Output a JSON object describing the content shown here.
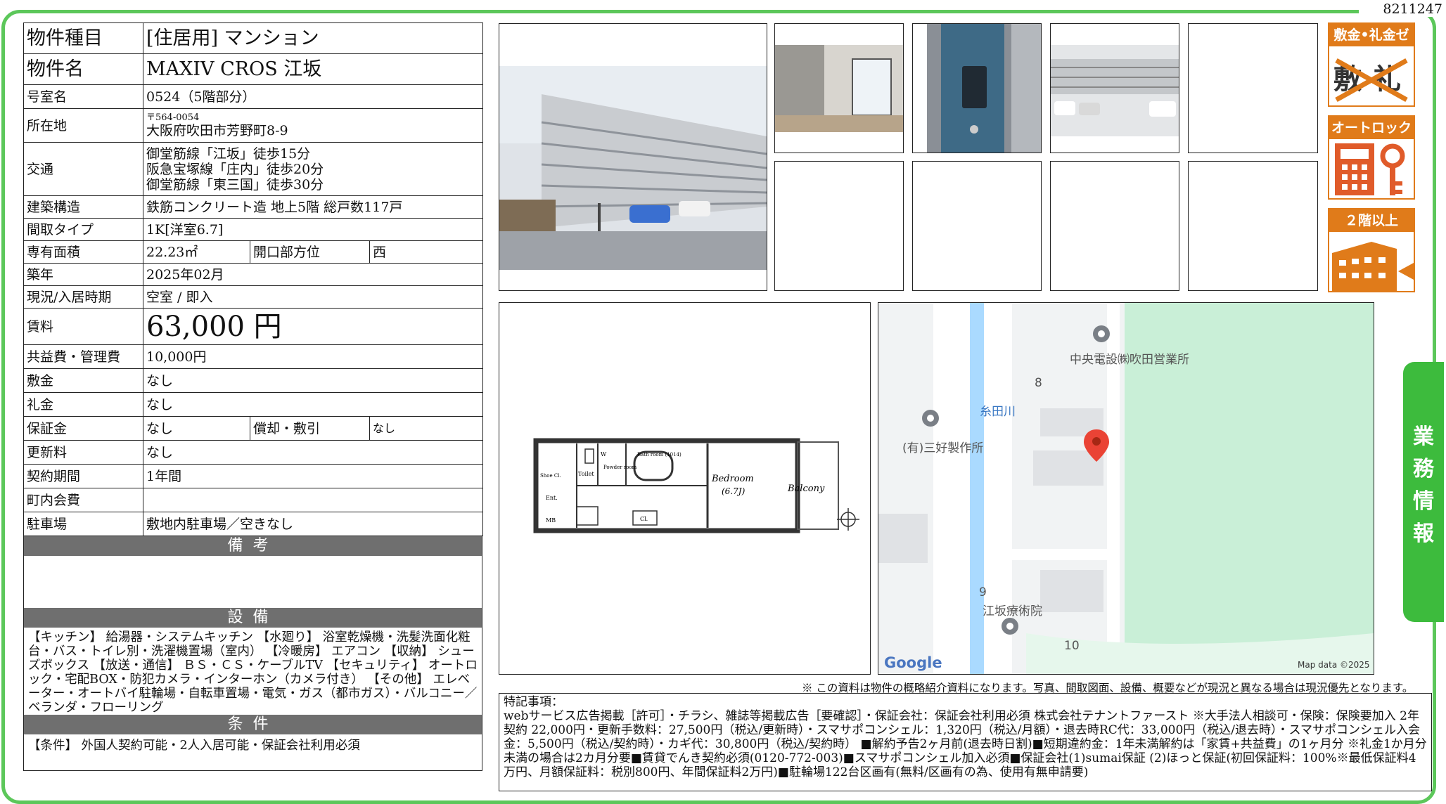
{
  "doc_id": "8211247",
  "property": {
    "type_label": "物件種目",
    "type_value": "[住居用] マンション",
    "name_label": "物件名",
    "name_value": "MAXIV CROS 江坂",
    "room_label": "号室名",
    "room_value": "0524（5階部分）",
    "address_label": "所在地",
    "address_zip": "〒564-0054",
    "address_value": "大阪府吹田市芳野町8-9",
    "access_label": "交通",
    "access": [
      "御堂筋線「江坂」徒歩15分",
      "阪急宝塚線「庄内」徒歩20分",
      "御堂筋線「東三国」徒歩30分"
    ],
    "structure_label": "建築構造",
    "structure_value": "鉄筋コンクリート造 地上5階 総戸数117戸",
    "layout_label": "間取タイプ",
    "layout_value": "1K[洋室6.7]",
    "area_label": "専有面積",
    "area_value": "22.23㎡",
    "direction_label": "開口部方位",
    "direction_value": "西",
    "built_label": "築年",
    "built_value": "2025年02月",
    "status_label": "現況/入居時期",
    "status_value": "空室 / 即入",
    "rent_label": "賃料",
    "rent_value": "63,000 円",
    "fee_label": "共益費・管理費",
    "fee_value": "10,000円",
    "deposit_label": "敷金",
    "deposit_value": "なし",
    "keymoney_label": "礼金",
    "keymoney_value": "なし",
    "guarantee_label": "保証金",
    "guarantee_value": "なし",
    "amort_label": "償却・敷引",
    "amort_value": "なし",
    "renewal_label": "更新料",
    "renewal_value": "なし",
    "term_label": "契約期間",
    "term_value": "1年間",
    "town_label": "町内会費",
    "town_value": "",
    "parking_label": "駐車場",
    "parking_value": "敷地内駐車場／空きなし"
  },
  "sections": {
    "bikou": "備考",
    "setsubi": "設備",
    "setsubi_text": "【キッチン】 給湯器・システムキッチン 【水廻り】 浴室乾燥機・洗髪洗面化粧台・バス・トイレ別・洗濯機置場（室内） 【冷暖房】 エアコン 【収納】 シューズボックス 【放送・通信】 ＢＳ・ＣＳ・ケーブルTV 【セキュリティ】 オートロック・宅配BOX・防犯カメラ・インターホン（カメラ付き） 【その他】 エレベーター・オートバイ駐輪場・自転車置場・電気・ガス（都市ガス）・バルコニー／ベランダ・フローリング",
    "jouken": "条件",
    "jouken_text": "【条件】 外国人契約可能・2人入居可能・保証会社利用必須"
  },
  "badges": {
    "b1": "敷金•礼金ゼロ",
    "b2": "オートロック",
    "b3": "２階以上"
  },
  "tab": [
    "業",
    "務",
    "情",
    "報"
  ],
  "floorplan": {
    "bedroom": "Bedroom",
    "bedroom_size": "(6.7J)",
    "balcony": "Balcony",
    "bath": "Bath room (1014)",
    "toilet": "Toilet",
    "powder": "Powder room",
    "ent": "Ent.",
    "shoe": "Shoe Cl.",
    "wm": "W",
    "mb": "MB",
    "cl": "Cl."
  },
  "map": {
    "label1": "中央電設㈱吹田営業所",
    "label2": "(有)三好製作所",
    "label3": "江坂療術院",
    "river": "糸田川",
    "n8": "8",
    "n9": "9",
    "n10": "10",
    "google": "Google",
    "mapdata": "Map data ©2025"
  },
  "note": "※ この資料は物件の概略紹介資料になります。写真、間取図面、設備、概要などが現況と異なる場合は現況優先となります。",
  "remarks_title": "特記事項：",
  "remarks_text": "webサービス広告掲載［許可］・チラシ、雑誌等掲載広告［要確認］・保証会社：保証会社利用必須 株式会社テナントファースト ※大手法人相談可・保険：保険要加入 2年契約 22,000円・更新手数料：27,500円（税込/更新時）・スマサポコンシェル：1,320円（税込/月額）・退去時RC代：33,000円（税込/退去時）・スマサポコンシェル入会金：5,500円（税込/契約時）・カギ代：30,800円（税込/契約時） ■解約予告2ヶ月前(退去時日割)■短期違約金：1年未満解約は「家賃+共益費」の1ヶ月分 ※礼金1か月分未満の場合は2カ月分要■賃貸でんき契約必須(0120-772-003)■スマサポコンシェル加入必須■保証会社(1)sumai保証 (2)ほっと保証(初回保証料：100%※最低保証料4万円、月額保証料：税別800円、年間保証料2万円)■駐輪場122台区画有(無料/区画有の為、使用有無申請要)"
}
